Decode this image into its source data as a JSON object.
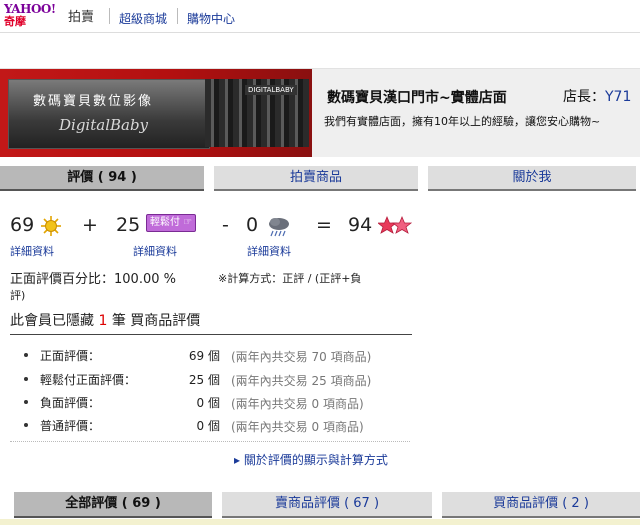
{
  "header": {
    "logo_line1": "YAHOO!",
    "logo_line2": "奇摩",
    "site_section": "拍賣",
    "nav": [
      {
        "label": "超級商城"
      },
      {
        "label": "購物中心"
      }
    ]
  },
  "banner": {
    "brand_cn": "數碼寶貝數位影像",
    "brand_en": "DigitalBaby",
    "photo_sign": "DIGITALBABY",
    "store_name": "數碼寶貝漢口門市~實體店面",
    "owner_label": "店長：",
    "owner_id": "Y71",
    "slogan": "我們有實體店面，擁有10年以上的經驗，讓您安心購物~"
  },
  "tabs": [
    {
      "label": "評價 ( 94 )",
      "active": true
    },
    {
      "label": "拍賣商品",
      "active": false
    },
    {
      "label": "關於我",
      "active": false
    }
  ],
  "score": {
    "positive": "69",
    "plus": "+",
    "easy_positive": "25",
    "easy_badge": "輕鬆付",
    "minus": "-",
    "negative": "0",
    "equals": "=",
    "total": "94",
    "detail_label": "詳細資料",
    "colors": {
      "sun": "#f2c31a",
      "star": "#e83a5a",
      "badge": "#c06bd9"
    }
  },
  "summary": {
    "percent_text": "正面評價百分比：100.00 %",
    "calc_text": "※計算方式：正評 / (正評+負",
    "calc_text2": "評)",
    "hidden_prefix": "此會員已隱藏",
    "hidden_count": "1",
    "hidden_suffix": "筆 買商品評價"
  },
  "stats": [
    {
      "label": "正面評價：",
      "count": "69 個",
      "note": "(兩年內共交易 70 項商品)"
    },
    {
      "label": "輕鬆付正面評價：",
      "count": "25 個",
      "note": "(兩年內共交易 25 項商品)"
    },
    {
      "label": "負面評價：",
      "count": "0 個",
      "note": "(兩年內共交易 0 項商品)"
    },
    {
      "label": "普通評價：",
      "count": "0 個",
      "note": "(兩年內共交易 0 項商品)"
    }
  ],
  "about_link": "關於評價的顯示與計算方式",
  "bottom_tabs": [
    {
      "label": "全部評價 ( 69 )",
      "active": true
    },
    {
      "label": "賣商品評價 ( 67 )",
      "active": false
    },
    {
      "label": "買商品評價 ( 2 )",
      "active": false
    }
  ]
}
